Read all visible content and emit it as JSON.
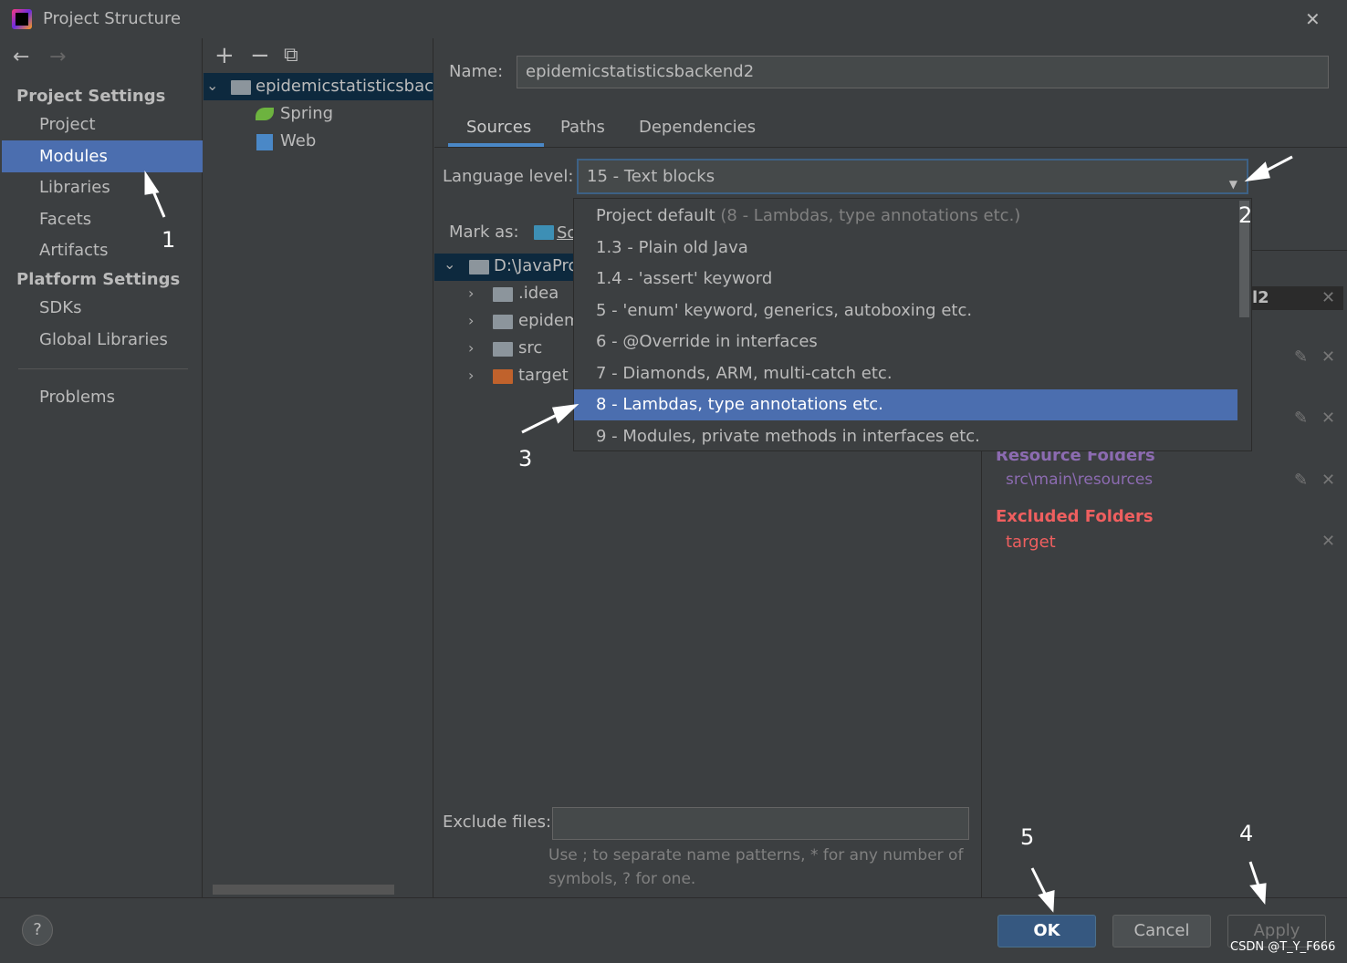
{
  "window": {
    "title": "Project Structure",
    "close": "✕"
  },
  "nav": {
    "back": "←",
    "forward": "→",
    "project_settings": "Project Settings",
    "items1": [
      "Project",
      "Modules",
      "Libraries",
      "Facets",
      "Artifacts"
    ],
    "platform_settings": "Platform Settings",
    "items2": [
      "SDKs",
      "Global Libraries"
    ],
    "problems": "Problems"
  },
  "toolbar": {
    "add": "+",
    "remove": "−",
    "copy": "⧉"
  },
  "modules": {
    "root": "epidemicstatisticsbackend2",
    "children": [
      "Spring",
      "Web"
    ]
  },
  "name_field": {
    "label": "Name:",
    "value": "epidemicstatisticsbackend2"
  },
  "tabs": [
    "Sources",
    "Paths",
    "Dependencies"
  ],
  "language_level": {
    "label": "Language level:",
    "value": "15 - Text blocks",
    "options": [
      {
        "main": "Project default",
        "hint": "(8 - Lambdas, type annotations etc.)"
      },
      {
        "main": "1.3 - Plain old Java"
      },
      {
        "main": "1.4 - 'assert' keyword"
      },
      {
        "main": "5 - 'enum' keyword, generics, autoboxing etc."
      },
      {
        "main": "6 - @Override in interfaces"
      },
      {
        "main": "7 - Diamonds, ARM, multi-catch etc."
      },
      {
        "main": "8 - Lambdas, type annotations etc."
      },
      {
        "main": "9 - Modules, private methods in interfaces etc."
      }
    ],
    "selected_index": 6
  },
  "mark_as": {
    "label": "Mark as:",
    "first": "So"
  },
  "tree": {
    "root": "D:\\JavaPro",
    "children": [
      ".idea",
      "epidem",
      "src",
      "target"
    ]
  },
  "roots": {
    "partial_root": "l2",
    "resource_header": "Resource Folders",
    "resource_path": "src\\main\\resources",
    "excluded_header": "Excluded Folders",
    "excluded_path": "target"
  },
  "exclude": {
    "label": "Exclude files:",
    "value": "",
    "help1": "Use ; to separate name patterns, * for any number of",
    "help2": "symbols, ? for one."
  },
  "buttons": {
    "help": "?",
    "ok": "OK",
    "cancel": "Cancel",
    "apply": "Apply"
  },
  "annotations": [
    "1",
    "2",
    "3",
    "4",
    "5"
  ],
  "watermark": "CSDN @T_Y_F666",
  "colors": {
    "accent": "#4b6eaf",
    "excluded": "#e06c75",
    "resource": "#8c6bb1"
  }
}
